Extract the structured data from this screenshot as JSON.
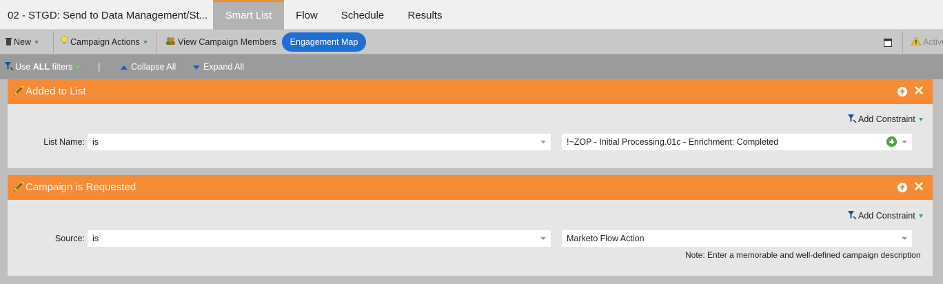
{
  "header": {
    "program_title": "02 - STGD: Send to Data Management/St...",
    "tabs": [
      {
        "label": "Smart List",
        "active": true
      },
      {
        "label": "Flow",
        "active": false
      },
      {
        "label": "Schedule",
        "active": false
      },
      {
        "label": "Results",
        "active": false
      }
    ]
  },
  "toolbar": {
    "new_label": "New",
    "campaign_actions_label": "Campaign Actions",
    "view_members_label": "View Campaign Members",
    "engagement_map_label": "Engagement Map",
    "status_label": "Active"
  },
  "filter_bar": {
    "use_filters_prefix": "Use ",
    "use_filters_bold": "ALL",
    "use_filters_suffix": " filters",
    "separator": "|",
    "collapse_all_label": "Collapse All",
    "expand_all_label": "Expand All"
  },
  "filters": [
    {
      "title": "Added to List",
      "add_constraint_label": "Add Constraint",
      "field_label": "List Name:",
      "operator": "is",
      "value": "!~ZOP - Initial Processing.01c - Enrichment: Completed"
    },
    {
      "title": "Campaign is Requested",
      "add_constraint_label": "Add Constraint",
      "field_label": "Source:",
      "operator": "is",
      "value": "Marketo Flow Action",
      "note": "Note: Enter a memorable and well-defined campaign description"
    }
  ],
  "colors": {
    "accent_orange": "#f68b36",
    "engagement_blue": "#1f6ed6",
    "active_tab_bg": "#b3b3b3"
  },
  "icons": [
    "trash-icon",
    "lightbulb-icon",
    "people-icon",
    "window-icon",
    "warning-icon",
    "funnel-icon",
    "collapse-icon",
    "expand-icon",
    "filter-icon",
    "add-constraint-icon",
    "move-up-icon",
    "close-icon",
    "add-icon",
    "dropdown-caret-icon"
  ]
}
